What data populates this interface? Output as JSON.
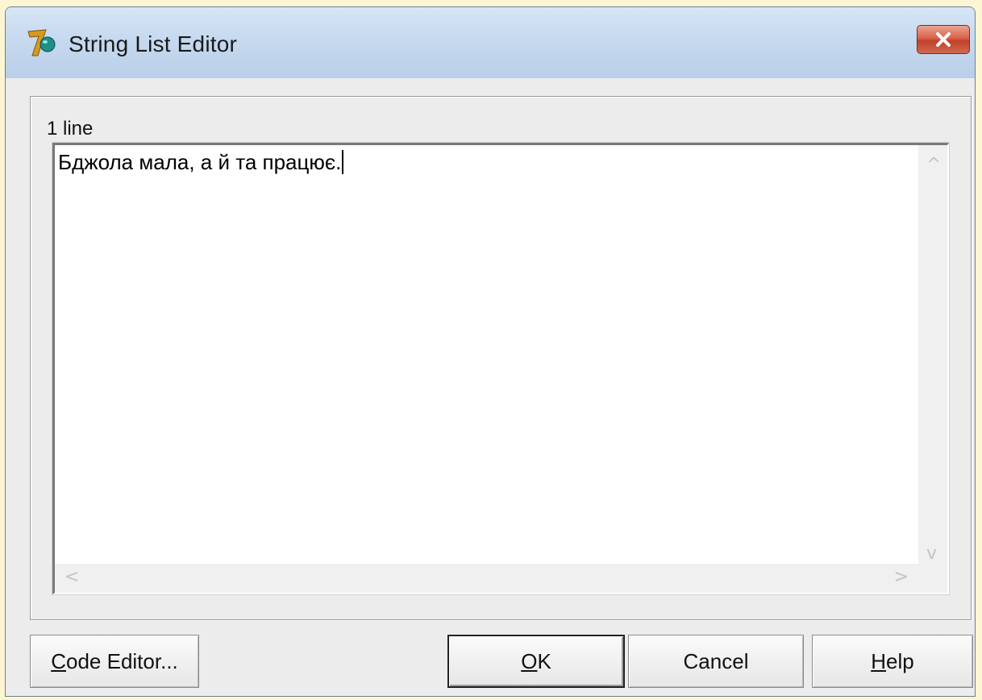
{
  "window": {
    "title": "String List Editor",
    "app_icon": "app-logo-icon",
    "close_icon": "close-icon"
  },
  "editor": {
    "line_count": "1 line",
    "text": "Бджола мала, а й та працює.",
    "scroll_up_icon": "^",
    "scroll_down_icon": "v",
    "scroll_left_icon": "<",
    "scroll_right_icon": ">"
  },
  "buttons": {
    "code_editor": {
      "hotkey": "C",
      "rest": "ode Editor..."
    },
    "ok": {
      "hotkey": "O",
      "rest": "K"
    },
    "cancel": {
      "label": "Cancel"
    },
    "help": {
      "hotkey": "H",
      "rest": "elp"
    }
  },
  "colors": {
    "titlebar": "#c6d9ef",
    "close_button": "#d9624a",
    "background": "#fdf6d3"
  }
}
